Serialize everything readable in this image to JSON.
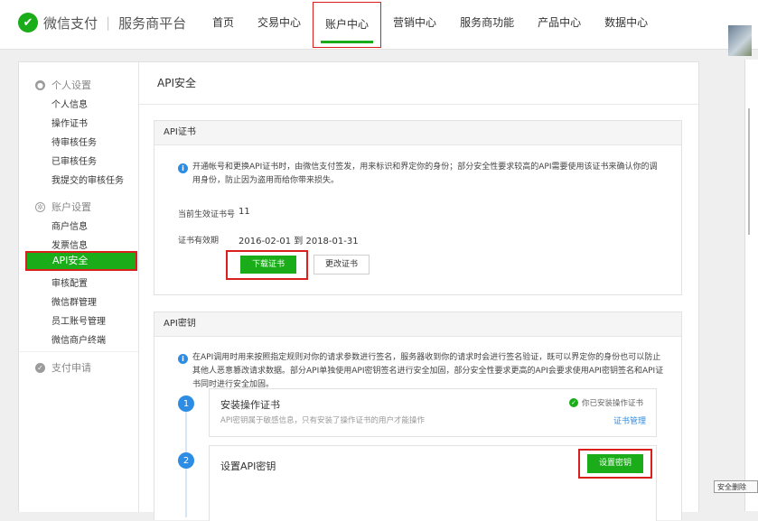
{
  "header": {
    "logo_text": "微信支付",
    "separator": "|",
    "platform_name": "服务商平台",
    "nav": [
      "首页",
      "交易中心",
      "账户中心",
      "营销中心",
      "服务商功能",
      "产品中心",
      "数据中心"
    ],
    "active_nav_index": 2
  },
  "sidebar": {
    "group1_title": "个人设置",
    "group1_items": [
      "个人信息",
      "操作证书",
      "待审核任务",
      "已审核任务",
      "我提交的审核任务"
    ],
    "group2_title": "账户设置",
    "group2_items": [
      "商户信息",
      "发票信息",
      "API安全",
      "审核配置",
      "微信群管理",
      "员工账号管理",
      "微信商户终端"
    ],
    "active_item": "API安全",
    "group3_title": "支付申请"
  },
  "content": {
    "page_title": "API安全",
    "cert_panel": {
      "title": "API证书",
      "notice": "开通帐号和更换API证书时，由微信支付签发，用来标识和界定你的身份；部分安全性要求较高的API需要使用该证书来确认你的调用身份，防止因为盗用而给你带来损失。",
      "serial_label": "当前生效证书号",
      "serial_value": "11",
      "validity_label": "证书有效期",
      "validity_value": "2016-02-01  到  2018-01-31",
      "download_button": "下载证书",
      "change_button": "更改证书"
    },
    "key_panel": {
      "title": "API密钥",
      "notice": "在API调用时用来按照指定规则对你的请求参数进行签名，服务器收到你的请求时会进行签名验证，既可以界定你的身份也可以防止其他人恶意篡改请求数据。部分API单独使用API密钥签名进行安全加固，部分安全性要求更高的API会要求使用API密钥签名和API证书同时进行安全加固。",
      "step1": {
        "num": "1",
        "title": "安装操作证书",
        "desc": "API密钥属于敏感信息，只有安装了操作证书的用户才能操作",
        "status": "你已安装操作证书",
        "link": "证书管理"
      },
      "step2": {
        "num": "2",
        "title": "设置API密钥",
        "button": "设置密钥"
      }
    }
  },
  "corner_button": "安全删除",
  "colors": {
    "brand_green": "#1aad19",
    "highlight_red": "#d9201d",
    "info_blue": "#2d8ce3"
  }
}
